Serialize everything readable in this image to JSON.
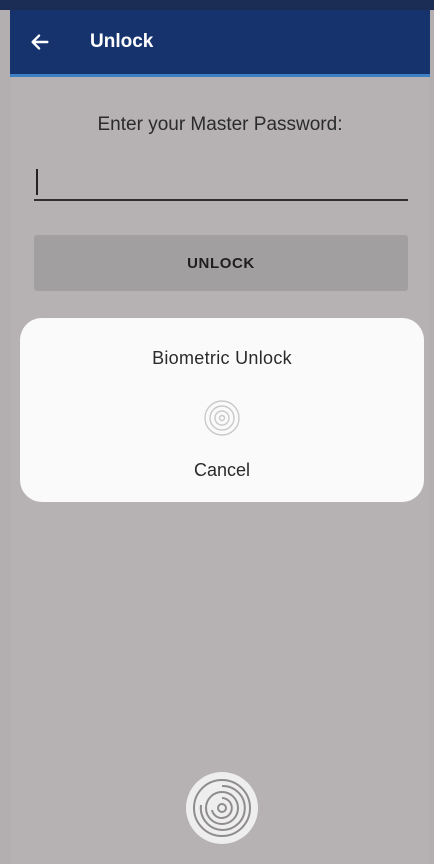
{
  "appbar": {
    "title": "Unlock",
    "back_icon": "arrow-left-icon"
  },
  "form": {
    "prompt": "Enter your Master Password:",
    "password_value": "",
    "unlock_label": "UNLOCK"
  },
  "biometric_dialog": {
    "title": "Biometric Unlock",
    "fingerprint_icon": "fingerprint-icon",
    "cancel_label": "Cancel"
  },
  "sensor": {
    "icon": "fingerprint-sensor-icon"
  },
  "colors": {
    "appbar": "#16336d",
    "accent": "#3f7fc5",
    "background": "#b6b2b4",
    "dialog": "#fbfafb",
    "button": "#a29fa1"
  }
}
